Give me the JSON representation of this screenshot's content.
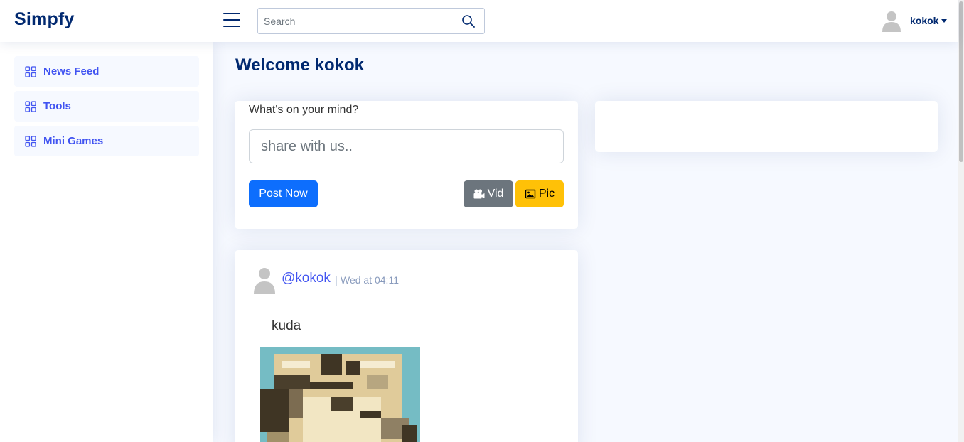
{
  "header": {
    "logo": "Simpfy",
    "search_placeholder": "Search",
    "user_name": "kokok"
  },
  "sidebar": {
    "items": [
      {
        "label": "News Feed",
        "icon": "grid-icon"
      },
      {
        "label": "Tools",
        "icon": "grid-icon"
      },
      {
        "label": "Mini Games",
        "icon": "grid-icon"
      }
    ]
  },
  "main": {
    "welcome_prefix": "Welcome ",
    "welcome_name": "kokok",
    "composer": {
      "label": "What's on your mind?",
      "placeholder": "share with us..",
      "post_button": "Post Now",
      "video_button": "Vid",
      "picture_button": "Pic"
    },
    "feed": [
      {
        "username": "@kokok",
        "separator": "|",
        "time": "Wed at 04:11",
        "text": "kuda"
      }
    ]
  },
  "colors": {
    "brand": "#012970",
    "accent": "#4154f1",
    "primary_button": "#0d6efd",
    "secondary_button": "#6c757d",
    "warning_button": "#ffc107",
    "page_background": "#f6f9ff"
  }
}
